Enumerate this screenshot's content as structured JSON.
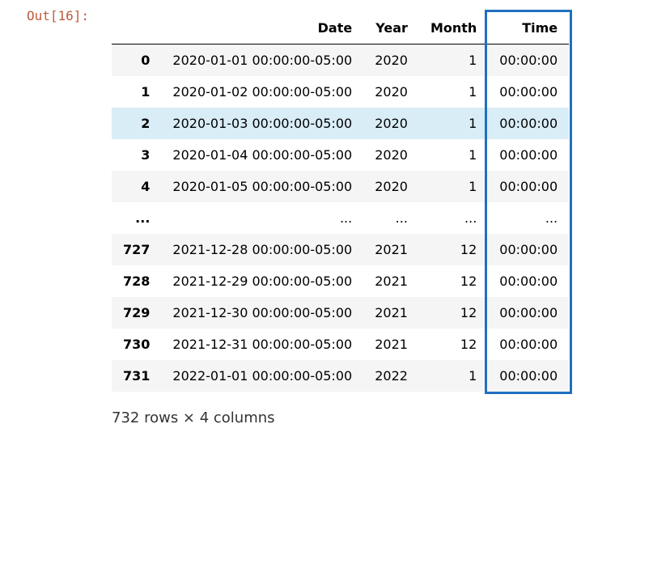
{
  "prompt": "Out[16]:",
  "headers": {
    "index": "",
    "col0": "Date",
    "col1": "Year",
    "col2": "Month",
    "col3": "Time"
  },
  "rows": [
    {
      "index": "0",
      "date": "2020-01-01 00:00:00-05:00",
      "year": "2020",
      "month": "1",
      "time": "00:00:00",
      "hl": false
    },
    {
      "index": "1",
      "date": "2020-01-02 00:00:00-05:00",
      "year": "2020",
      "month": "1",
      "time": "00:00:00",
      "hl": false
    },
    {
      "index": "2",
      "date": "2020-01-03 00:00:00-05:00",
      "year": "2020",
      "month": "1",
      "time": "00:00:00",
      "hl": true
    },
    {
      "index": "3",
      "date": "2020-01-04 00:00:00-05:00",
      "year": "2020",
      "month": "1",
      "time": "00:00:00",
      "hl": false
    },
    {
      "index": "4",
      "date": "2020-01-05 00:00:00-05:00",
      "year": "2020",
      "month": "1",
      "time": "00:00:00",
      "hl": false
    },
    {
      "index": "...",
      "date": "...",
      "year": "...",
      "month": "...",
      "time": "...",
      "hl": false
    },
    {
      "index": "727",
      "date": "2021-12-28 00:00:00-05:00",
      "year": "2021",
      "month": "12",
      "time": "00:00:00",
      "hl": false
    },
    {
      "index": "728",
      "date": "2021-12-29 00:00:00-05:00",
      "year": "2021",
      "month": "12",
      "time": "00:00:00",
      "hl": false
    },
    {
      "index": "729",
      "date": "2021-12-30 00:00:00-05:00",
      "year": "2021",
      "month": "12",
      "time": "00:00:00",
      "hl": false
    },
    {
      "index": "730",
      "date": "2021-12-31 00:00:00-05:00",
      "year": "2021",
      "month": "12",
      "time": "00:00:00",
      "hl": false
    },
    {
      "index": "731",
      "date": "2022-01-01 00:00:00-05:00",
      "year": "2022",
      "month": "1",
      "time": "00:00:00",
      "hl": false
    }
  ],
  "footer": "732 rows × 4 columns"
}
